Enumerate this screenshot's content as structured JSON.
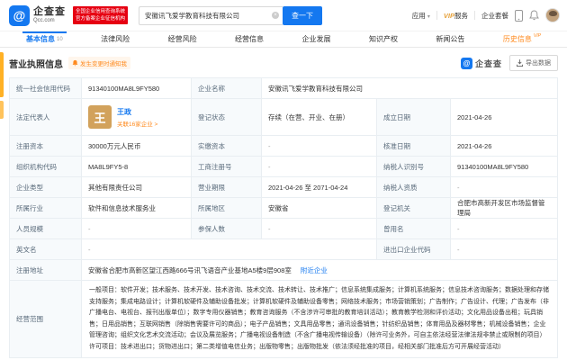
{
  "brand": {
    "name": "企查查",
    "domain": "Qcc.com",
    "logo_glyph": "@",
    "badge_line1": "全国企业信用查询系统",
    "badge_line2": "官方备案企业征信机构"
  },
  "header": {
    "search_value": "安徽讯飞爱学教育科技有限公司",
    "search_button": "查一下",
    "apps": "应用",
    "vip_prefix": "VIP",
    "vip_suffix": "服务",
    "package": "企业套餐"
  },
  "tabs": {
    "basic": {
      "label": "基本信息",
      "count": "10"
    },
    "legal": {
      "label": "法律风险"
    },
    "operation_risk": {
      "label": "经营风险"
    },
    "operation_info": {
      "label": "经营信息"
    },
    "development": {
      "label": "企业发展"
    },
    "ip": {
      "label": "知识产权"
    },
    "news": {
      "label": "新闻公告"
    },
    "history": {
      "label": "历史信息",
      "vip": "VIP"
    }
  },
  "section": {
    "title": "营业执照信息",
    "notify": "发生变更时通知我",
    "watermark_glyph": "@",
    "watermark": "企查查",
    "export": "导出数据"
  },
  "license": {
    "credit_code": {
      "label": "统一社会信用代码",
      "value": "91340100MA8L9FY580"
    },
    "company_name": {
      "label": "企业名称",
      "value": "安徽讯飞爱学教育科技有限公司"
    },
    "legal_rep": {
      "label": "法定代表人",
      "avatar_char": "王",
      "name": "王政",
      "related": "关联16家企业 >"
    },
    "reg_status": {
      "label": "登记状态",
      "value": "存续（在营、开业、在册）"
    },
    "establish_date": {
      "label": "成立日期",
      "value": "2021-04-26"
    },
    "reg_capital": {
      "label": "注册资本",
      "value": "30000万元人民币"
    },
    "paid_capital": {
      "label": "实缴资本",
      "value": "-"
    },
    "approval_date": {
      "label": "核准日期",
      "value": "2021-04-26"
    },
    "org_code": {
      "label": "组织机构代码",
      "value": "MA8L9FY5-8"
    },
    "business_reg_no": {
      "label": "工商注册号",
      "value": "-"
    },
    "taxpayer_id": {
      "label": "纳税人识别号",
      "value": "91340100MA8L9FY580"
    },
    "company_type": {
      "label": "企业类型",
      "value": "其他有限责任公司"
    },
    "business_term": {
      "label": "营业期限",
      "value": "2021-04-26 至 2071-04-24"
    },
    "taxpayer_qualification": {
      "label": "纳税人资质",
      "value": "-"
    },
    "industry": {
      "label": "所属行业",
      "value": "软件和信息技术服务业"
    },
    "region": {
      "label": "所属地区",
      "value": "安徽省"
    },
    "registration_authority": {
      "label": "登记机关",
      "value": "合肥市高新开发区市场监督管理局"
    },
    "staff_size": {
      "label": "人员规模",
      "value": "-"
    },
    "insured_count": {
      "label": "参保人数",
      "value": "-"
    },
    "former_name": {
      "label": "曾用名",
      "value": "-"
    },
    "english_name": {
      "label": "英文名",
      "value": "-"
    },
    "import_export_code": {
      "label": "进出口企业代码",
      "value": "-"
    },
    "address": {
      "label": "注册地址",
      "value": "安徽省合肥市高新区望江西路666号讯飞语音产业基地A5楼9层908室",
      "link": "附近企业"
    },
    "business_scope": {
      "label": "经营范围",
      "value": "一般项目：软件开发；技术服务、技术开发、技术咨询、技术交流、技术转让、技术推广；信息系统集成服务；计算机系统服务；信息技术咨询服务；数据处理和存储支持服务；集成电路设计；计算机软硬件及辅助设备批发；计算机软硬件及辅助设备零售；网络技术服务；市场营销策划；广告制作；广告设计、代理；广告发布（非广播电台、电视台、报刊出版单位）；数字专用仪器销售；教育咨询服务（不含涉许可审批的教育培训活动）；教育教学检测和评价活动；文化用品设备出租；玩具销售；日用品销售；互联网销售（除销售需要许可的商品）；电子产品销售；文具用品零售；通讯设备销售；针纺织品销售；体育用品及器材零售；机械设备销售；企业管理咨询；组织文化艺术交流活动；会议及展览服务；广播电视设备制造（不含广播电视传输设备）（除许可业务外，可自主依法经营法律法规非禁止或限制的项目）许可项目：技术进出口；货物进出口；第二类增值电信业务；出版物零售；出版物批发（依法须经批准的项目，经相关部门批准后方可开展经营活动）"
    }
  }
}
